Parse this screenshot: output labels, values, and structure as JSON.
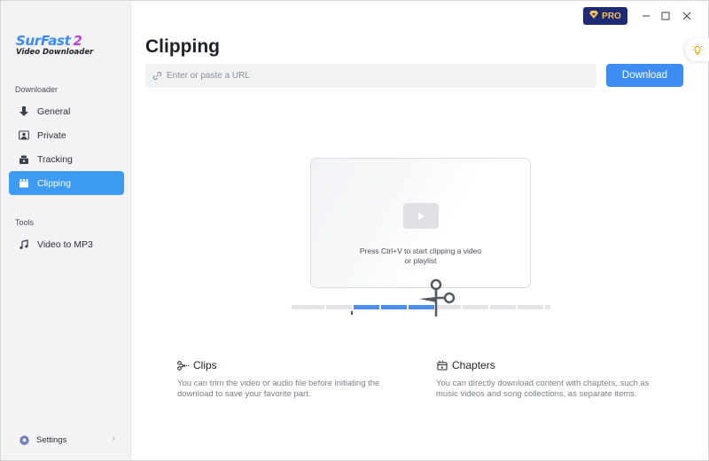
{
  "app": {
    "logo_name": "SurFast",
    "logo_version": "2",
    "logo_subtitle": "Video Downloader",
    "pro_label": "PRO"
  },
  "sidebar": {
    "sections": [
      {
        "label": "Downloader",
        "items": [
          {
            "label": "General",
            "icon": "download-arrow-icon",
            "active": false
          },
          {
            "label": "Private",
            "icon": "private-user-icon",
            "active": false
          },
          {
            "label": "Tracking",
            "icon": "tracking-icon",
            "active": false
          },
          {
            "label": "Clipping",
            "icon": "clipping-icon",
            "active": true
          }
        ]
      },
      {
        "label": "Tools",
        "items": [
          {
            "label": "Video to MP3",
            "icon": "music-note-icon",
            "active": false
          }
        ]
      }
    ],
    "settings_label": "Settings"
  },
  "main": {
    "title": "Clipping",
    "url_placeholder": "Enter or paste a URL",
    "url_value": "",
    "download_label": "Download",
    "drop_hint_line1": "Press Ctrl+V to start clipping a video",
    "drop_hint_line2": "or playlist",
    "features": [
      {
        "title": "Clips",
        "icon": "scissors-icon",
        "desc_line1": "You can trim the video or audio file before initiating the",
        "desc_line2": "download to save your favorite part."
      },
      {
        "title": "Chapters",
        "icon": "chapters-icon",
        "desc_line1": "You can directly download content with chapters, such as",
        "desc_line2": "music videos and song collections, as separate items."
      }
    ]
  },
  "colors": {
    "accent": "#3d8df3",
    "active_nav": "#3d9bf4",
    "pro_bg": "#1e2a73",
    "pro_text": "#f0c25a"
  }
}
